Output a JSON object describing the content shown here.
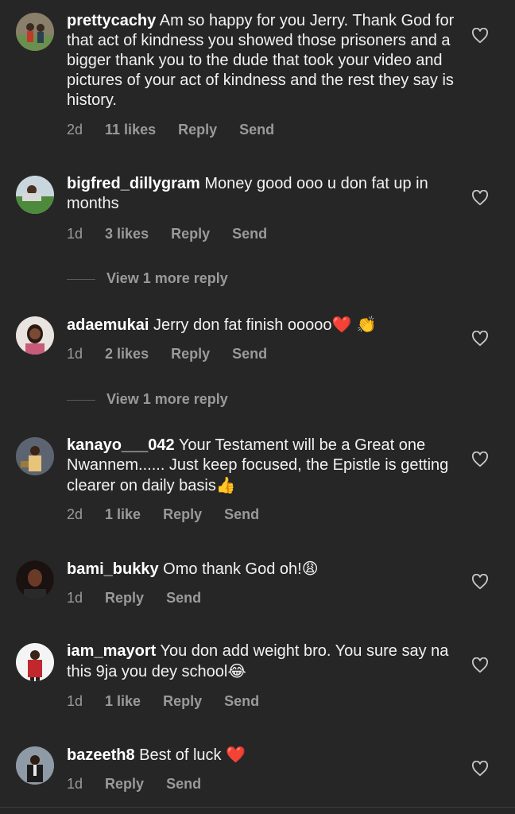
{
  "comments": [
    {
      "username": "prettycachy",
      "text": "Am so happy for you Jerry. Thank God for that act of kindness you showed those prisoners and a bigger thank you to the dude that took your video and pictures of your act of kindness and the rest they say is history.",
      "time": "2d",
      "likes": "11 likes",
      "reply": "Reply",
      "send": "Send"
    },
    {
      "username": "bigfred_dillygram",
      "text": "Money good ooo u don fat up in months",
      "time": "1d",
      "likes": "3 likes",
      "reply": "Reply",
      "send": "Send",
      "more_replies": "View 1 more reply"
    },
    {
      "username": "adaemukai",
      "text": "Jerry don fat finish ooooo",
      "emoji": "❤️ 👏",
      "time": "1d",
      "likes": "2 likes",
      "reply": "Reply",
      "send": "Send",
      "more_replies": "View 1 more reply"
    },
    {
      "username": "kanayo___042",
      "text": "Your Testament will be a Great one Nwannem...... Just keep focused, the Epistle is getting clearer on daily basis",
      "emoji": "👍",
      "time": "2d",
      "likes": "1 like",
      "reply": "Reply",
      "send": "Send"
    },
    {
      "username": "bami_bukky",
      "text": "Omo thank God oh!",
      "emoji": "😩",
      "time": "1d",
      "reply": "Reply",
      "send": "Send"
    },
    {
      "username": "iam_mayort",
      "text": "You don add weight bro. You sure say na this 9ja you dey school",
      "emoji": "😂",
      "time": "1d",
      "likes": "1 like",
      "reply": "Reply",
      "send": "Send"
    },
    {
      "username": "bazeeth8",
      "text": "Best of luck",
      "emoji": "❤️",
      "time": "1d",
      "reply": "Reply",
      "send": "Send"
    }
  ],
  "icons": {
    "like": "heart-outline-icon"
  },
  "colors": {
    "background": "#262626",
    "text": "#f2f2f2",
    "secondary": "#9a9a9a",
    "heart_red": "#e0245e"
  }
}
